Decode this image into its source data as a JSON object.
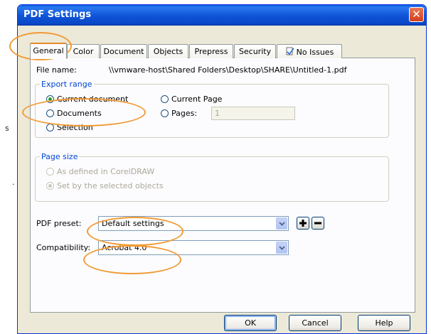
{
  "dialog": {
    "title": "PDF Settings",
    "close_glyph": "✕"
  },
  "background": {
    "letters": [
      "s",
      "."
    ]
  },
  "tabs": [
    {
      "label": "General"
    },
    {
      "label": "Color"
    },
    {
      "label": "Document"
    },
    {
      "label": "Objects"
    },
    {
      "label": "Prepress"
    },
    {
      "label": "Security"
    },
    {
      "label": "No Issues",
      "icon": "check-document-icon"
    }
  ],
  "general": {
    "file_name_label": "File name:",
    "file_name_value": "\\\\vmware-host\\Shared Folders\\Desktop\\SHARE\\Untitled-1.pdf",
    "export_range": {
      "legend": "Export range",
      "current_document": "Current document",
      "documents": "Documents",
      "selection": "Selection",
      "current_page": "Current Page",
      "pages": "Pages:",
      "pages_value": "1",
      "selected": "Current document"
    },
    "page_size": {
      "legend": "Page size",
      "as_defined": "As defined in CorelDRAW",
      "by_selected": "Set by the selected objects",
      "selected": "Set by the selected objects"
    },
    "pdf_preset_label": "PDF preset:",
    "pdf_preset_value": "Default settings",
    "add_glyph": "+",
    "remove_glyph": "−",
    "compatibility_label": "Compatibility:",
    "compatibility_value": "Acrobat 4.0"
  },
  "buttons": {
    "ok": "OK",
    "cancel": "Cancel",
    "help": "Help"
  },
  "colors": {
    "titlebar": "#0a48c8",
    "dialog_face": "#ece9d8",
    "highlight_circle": "#f29a34",
    "legend_text": "#0046d5"
  }
}
